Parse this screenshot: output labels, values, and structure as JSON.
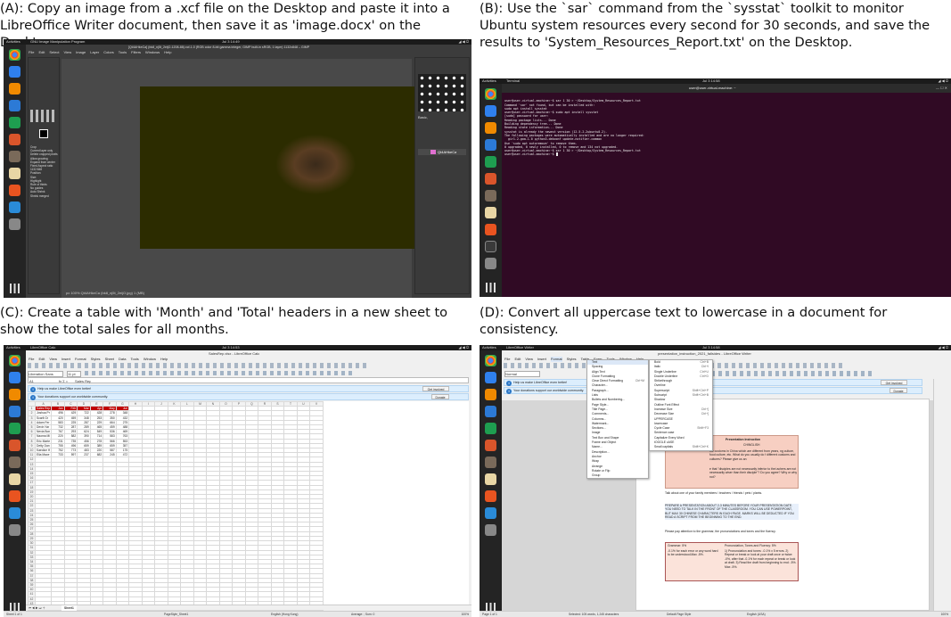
{
  "captions": {
    "a": "(A): Copy an image from a .xcf file on the Desktop and paste it into a LibreOffice Writer document, then save it as 'image.docx' on the Desktop.",
    "b": "(B): Use the `sar` command from the `sysstat` toolkit to monitor Ubuntu system resources every second for 30 seconds, and save the results to 'System_Resources_Report.txt' on the Desktop.",
    "c": "(C): Create a table with 'Month' and 'Total' headers in a new sheet to  show the total sales for all months.",
    "d": "(D): Convert all uppercase text to lowercase in a document for consistency."
  },
  "gimp": {
    "activities": "Activities",
    "app": "GNU Image Manipulation Program",
    "clock": "Jul 3 14:49",
    "title": "[Qt4AHkeCa] (bk8_nj5t_2eijO-1208-88).xcf-1.0 (RGB color 8-bit gamma integer, GIMP built-in sRGB, 1 layer) 1132x848 – GIMP",
    "menu": [
      "File",
      "Edit",
      "Select",
      "View",
      "Image",
      "Layer",
      "Colors",
      "Tools",
      "Filters",
      "Windows",
      "Help"
    ],
    "tool_options": [
      "Crop",
      "Current layer only",
      "Delete cropped pixels",
      "Allow growing",
      "Expand from center",
      "Fixed Aspect ratio",
      "1132:848",
      "Position:",
      "Size:",
      "Highlight",
      "Rule of thirds",
      "No guides",
      "Auto Shrink",
      "Shrink merged"
    ],
    "brushes_label": "Basic,",
    "layer_name": "Qt4AHkeCa",
    "statusbar": "px  100%  Qt4AHkeCa (bk8_nj5t_2eijO.jpg) 1 (MB)"
  },
  "terminal": {
    "activities": "Activities",
    "app": "Terminal",
    "clock": "Jul 3 14:58",
    "title": "user@user-virtual-machine: ~",
    "lines": [
      "user@user-virtual-machine:~$ sar 1 30 > ~/Desktop/System_Resources_Report.txt",
      "Command 'sar' not found, but can be installed with:",
      "sudo apt install sysstat",
      "user@user-virtual-machine:~$ sudo apt install sysstat",
      "[sudo] password for user:",
      "Reading package lists... Done",
      "Building dependency tree... Done",
      "Reading state information... Done",
      "sysstat is already the newest version (12.5.2-2ubuntu0.2).",
      "The following packages were automatically installed and are no longer required:",
      "  gir1.2-goa-1.0 python3-debconf update-notifier-common",
      "Use 'sudo apt autoremove' to remove them.",
      "0 upgraded, 0 newly installed, 0 to remove and 134 not upgraded.",
      "user@user-virtual-machine:~$ sar 1 30 > ~/Desktop/System_Resources_Report.txt",
      "user@user-virtual-machine:~$ "
    ]
  },
  "calc": {
    "activities": "Activities",
    "app": "LibreOffice Calc",
    "clock": "Jul 3 14:53",
    "title": "SalesRep.xlsx - LibreOffice Calc",
    "menu": [
      "File",
      "Edit",
      "View",
      "Insert",
      "Format",
      "Styles",
      "Sheet",
      "Data",
      "Tools",
      "Window",
      "Help"
    ],
    "font": "Liberation Sans",
    "size": "11 pt",
    "cellref": "A1",
    "formula": "Sales Rep",
    "info1": "Help us make LibreOffice even better!",
    "info1_btn": "Get involved",
    "info2": "Your donations support our worldwide community.",
    "info2_btn": "Donate",
    "cols": [
      "",
      "A",
      "B",
      "C",
      "D",
      "E",
      "F",
      "G",
      "H",
      "I",
      "J",
      "K",
      "L",
      "M",
      "N",
      "O",
      "P",
      "Q",
      "R",
      "S",
      "T",
      "U",
      "V"
    ],
    "rows": [
      [
        "Sales Rep",
        "Jan",
        "Feb",
        "Mar",
        "Apr",
        "May",
        "Jun"
      ],
      [
        "Joshua Pr",
        "496",
        "429",
        "722",
        "428",
        "278",
        "348"
      ],
      [
        "Scarlt Gr",
        "420",
        "459",
        "348",
        "253",
        "350",
        "432"
      ],
      [
        "Adam Fer",
        "583",
        "225",
        "287",
        "229",
        "664",
        "275"
      ],
      [
        "Devin Yar",
        "732",
        "287",
        "289",
        "465",
        "459",
        "488"
      ],
      [
        "Nevia Bon",
        "767",
        "293",
        "624",
        "549",
        "536",
        "469"
      ],
      [
        "Naoma Mi",
        "220",
        "582",
        "390",
        "714",
        "583",
        "763"
      ],
      [
        "Eric Marte",
        "231",
        "735",
        "456",
        "278",
        "566",
        "553"
      ],
      [
        "Detty Dan",
        "755",
        "496",
        "659",
        "389",
        "659",
        "357"
      ],
      [
        "Kaedice H",
        "752",
        "773",
        "483",
        "220",
        "587",
        "175"
      ],
      [
        "Elia Mace",
        "733",
        "597",
        "237",
        "682",
        "245",
        "472"
      ]
    ],
    "tab": "Sheet1",
    "status": {
      "sheet": "Sheet 1 of 1",
      "style": "PageStyle_Sheet1",
      "lang": "English (Hong Kong)",
      "avg": "Average: ; Sum: 0",
      "zoom": "100%"
    }
  },
  "writer": {
    "activities": "Activities",
    "app": "LibreOffice Writer",
    "clock": "Jul 3 14:58",
    "title": "presentation_instruction_2021_fallsides - LibreOffice Writer",
    "menu": [
      "File",
      "Edit",
      "View",
      "Insert",
      "Format",
      "Styles",
      "Table",
      "Form",
      "Tools",
      "Window",
      "Help"
    ],
    "style_box": "Normal",
    "info1": "Help us make LibreOffice even better!",
    "info1_btn": "Get involved",
    "info2": "Your donations support our worldwide community.",
    "info2_btn": "Donate",
    "format_menu": [
      {
        "label": "Text",
        "key": ""
      },
      {
        "label": "Spacing",
        "key": ""
      },
      {
        "label": "Align Text",
        "key": ""
      },
      {
        "label": "Clone Formatting",
        "key": ""
      },
      {
        "label": "Clear Direct Formatting",
        "key": "Ctrl+M"
      },
      {
        "label": "Character...",
        "key": ""
      },
      {
        "label": "Paragraph...",
        "key": ""
      },
      {
        "label": "Lists",
        "key": ""
      },
      {
        "label": "Bullets and Numbering...",
        "key": ""
      },
      {
        "label": "Page Style...",
        "key": ""
      },
      {
        "label": "Title Page...",
        "key": ""
      },
      {
        "label": "Comments...",
        "key": ""
      },
      {
        "label": "Columns...",
        "key": ""
      },
      {
        "label": "Watermark...",
        "key": ""
      },
      {
        "label": "Sections...",
        "key": ""
      },
      {
        "label": "Image",
        "key": ""
      },
      {
        "label": "Text Box and Shape",
        "key": ""
      },
      {
        "label": "Frame and Object",
        "key": ""
      },
      {
        "label": "Name...",
        "key": ""
      },
      {
        "label": "Description...",
        "key": ""
      },
      {
        "label": "Anchor",
        "key": ""
      },
      {
        "label": "Wrap",
        "key": ""
      },
      {
        "label": "Arrange",
        "key": ""
      },
      {
        "label": "Rotate or Flip",
        "key": ""
      },
      {
        "label": "Group",
        "key": ""
      }
    ],
    "text_submenu": [
      {
        "label": "Bold",
        "key": "Ctrl+B"
      },
      {
        "label": "Italic",
        "key": "Ctrl+I"
      },
      {
        "label": "Single Underline",
        "key": "Ctrl+U"
      },
      {
        "label": "Double Underline",
        "key": "Ctrl+D"
      },
      {
        "label": "Strikethrough",
        "key": ""
      },
      {
        "label": "Overline",
        "key": ""
      },
      {
        "label": "Superscript",
        "key": "Shift+Ctrl+P"
      },
      {
        "label": "Subscript",
        "key": "Shift+Ctrl+B"
      },
      {
        "label": "Shadow",
        "key": ""
      },
      {
        "label": "Outline Font Effect",
        "key": ""
      },
      {
        "label": "Increase Size",
        "key": "Ctrl+]"
      },
      {
        "label": "Decrease Size",
        "key": "Ctrl+["
      },
      {
        "label": "UPPERCASE",
        "key": ""
      },
      {
        "label": "lowercase",
        "key": ""
      },
      {
        "label": "Cycle Case",
        "key": "Shift+F3"
      },
      {
        "label": "Sentence case",
        "key": ""
      },
      {
        "label": "Capitalize Every Word",
        "key": ""
      },
      {
        "label": "tOGGLE cASE",
        "key": ""
      },
      {
        "label": "Small capitals",
        "key": "Shift+Ctrl+K"
      }
    ],
    "doc": {
      "heading": "Presentation Instruction",
      "heading2": "CHINGLISH",
      "p1": "me customs in China which are different from years, ng culture, food culture, etc. What do you usually do f different customs and cultures? Please give us an",
      "p2": "e that \"disciples are not necessarily inferior to thei achers are not necessarily wiser than their disciple\"? Do you agree? Why or why not?",
      "p3": "Talk about one of your family members / teachers / friends / pets / plants.",
      "p4": "PREPARE A PRESENTATION ABOUT 2-3 MINUTES BEFORE YOUR PRESENTATION DATE. YOU NEED TO TALK IN THE FRONT OF THE CLASSROOM. YOU CAN USE POWERPOINT, BUT MAX 30 CHINESE CHARACTERS IN EACH PAGE. MARKS WILL BE DEDUCTED IF YOU READ A SCRIPT FROM THE BEGINNING TO THE END.",
      "p5": "Please pay attention to the grammar, the pronunciations and tones and the fluency.",
      "t1h": "Grammar: 5%",
      "t2h": "Pronunciation, Tones and Fluency: 5%",
      "t1b": "-0.1% for each error or any word hard to be understood.Max -5%.",
      "t2b": "1) Pronunciation and tones: -0.1% x 5 errors. 2) Repeat or break or look at your draft once or twice: -0%, after that -0.1% for each repeat or break or look at draft. 3) Read the draft from beginning to end: -5%. Max -5%."
    },
    "status": {
      "page": "Page 1 of 1",
      "words": "Selected: 105 words, 1,245 characters",
      "style": "Default Page Style",
      "lang": "English (USA)",
      "zoom": "100%"
    }
  }
}
